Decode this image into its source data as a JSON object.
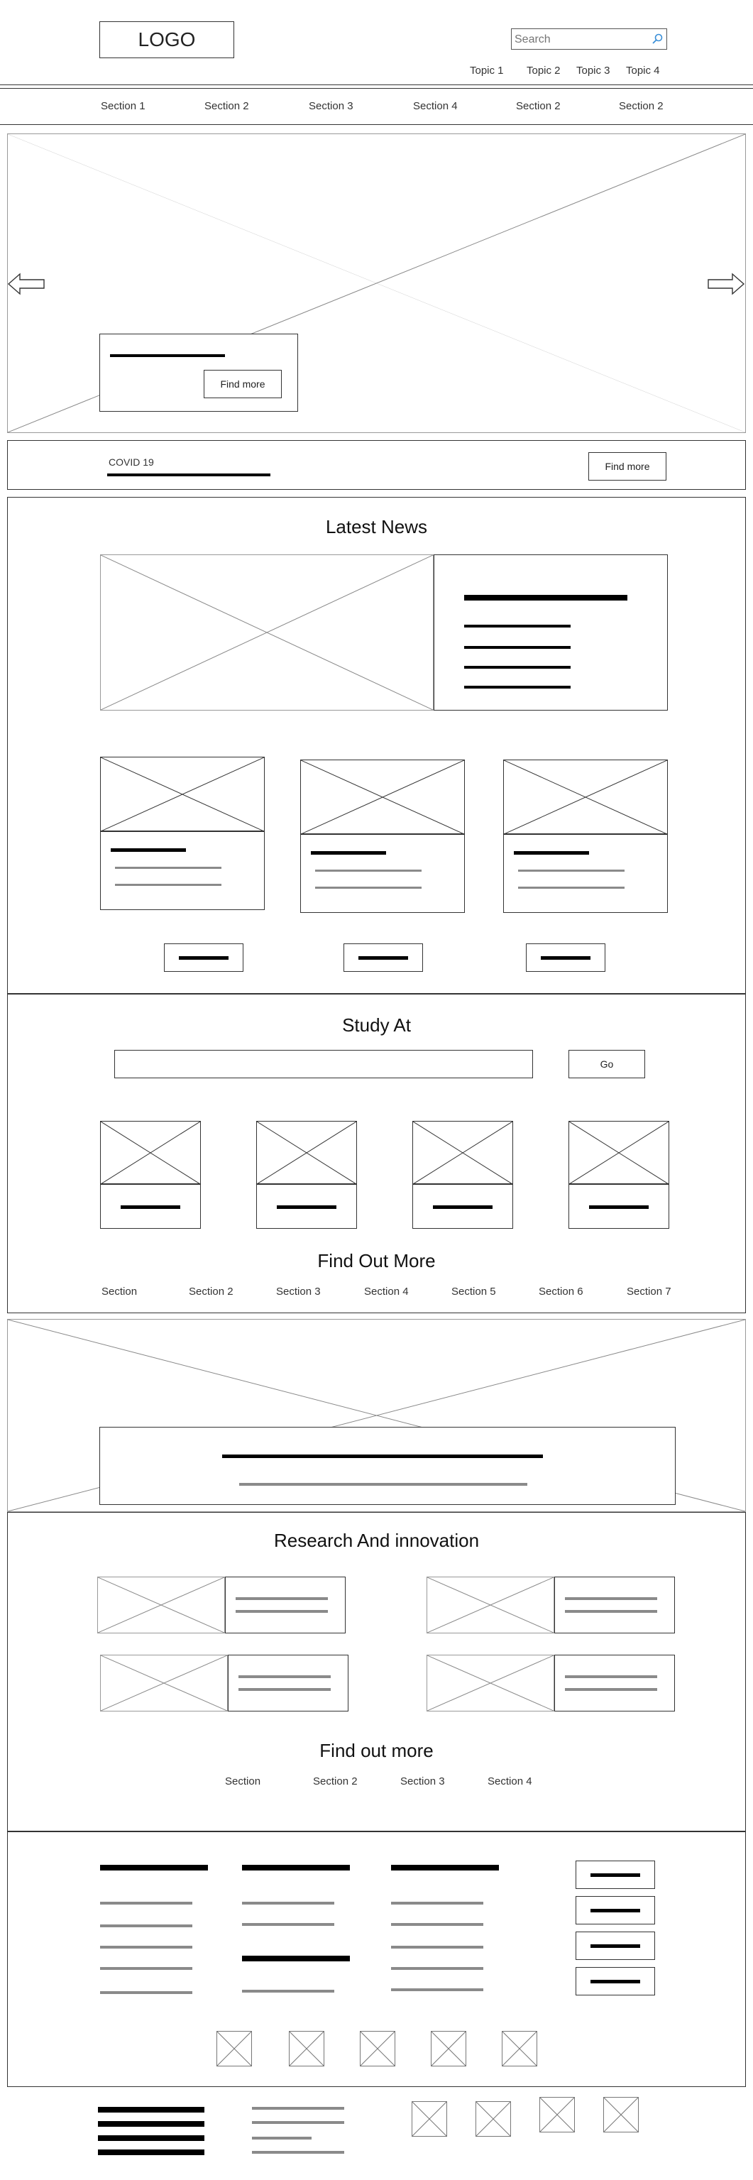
{
  "header": {
    "logo": "LOGO",
    "search_placeholder": "Search",
    "topics": [
      "Topic 1",
      "Topic 2",
      "Topic 3",
      "Topic 4"
    ]
  },
  "nav": {
    "items": [
      "Section 1",
      "Section 2",
      "Section 3",
      "Section 4",
      "Section 2",
      "Section 2"
    ]
  },
  "hero": {
    "button": "Find more"
  },
  "alert": {
    "label": "COVID 19",
    "button": "Find more"
  },
  "news": {
    "title": "Latest News"
  },
  "study": {
    "title": "Study At",
    "go_button": "Go"
  },
  "find_out": {
    "title": "Find Out More",
    "items": [
      "Section",
      "Section 2",
      "Section 3",
      "Section 4",
      "Section 5",
      "Section 6",
      "Section 7"
    ]
  },
  "research": {
    "title": "Research And innovation",
    "find_title": "Find out more",
    "items": [
      "Section",
      "Section 2",
      "Section 3",
      "Section 4"
    ]
  }
}
